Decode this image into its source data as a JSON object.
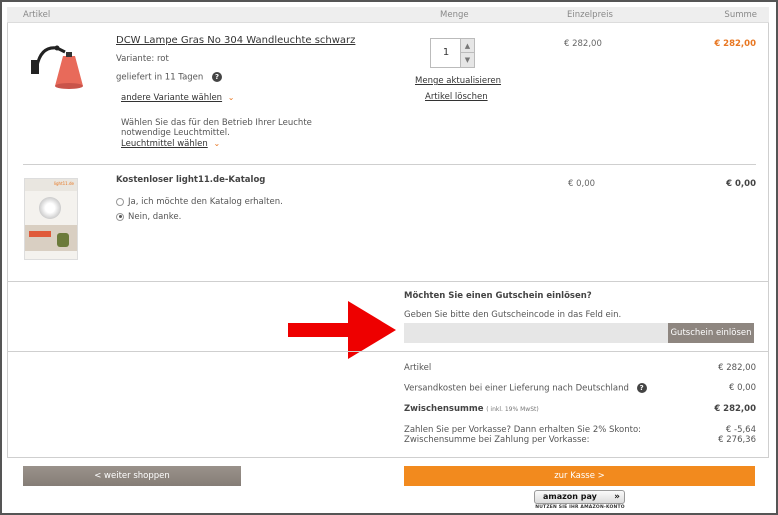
{
  "header": {
    "col_article": "Artikel",
    "col_qty": "Menge",
    "col_unit": "Einzelpreis",
    "col_sum": "Summe"
  },
  "item1": {
    "name": "DCW Lampe Gras No 304 Wandleuchte schwarz",
    "variant": "Variante: rot",
    "delivery": "geliefert in 11 Tagen",
    "other_variant": "andere Variante wählen",
    "bulb_note": "Wählen Sie das für den Betrieb Ihrer Leuchte notwendige Leuchtmittel.",
    "bulb_link": "Leuchtmittel wählen",
    "qty": "1",
    "update_link": "Menge aktualisieren",
    "delete_link": "Artikel löschen",
    "unit_price": "€ 282,00",
    "sum": "€ 282,00"
  },
  "item2": {
    "name": "Kostenloser light11.de-Katalog",
    "option_yes": "Ja, ich möchte den Katalog erhalten.",
    "option_no": "Nein, danke.",
    "unit_price": "€ 0,00",
    "sum": "€ 0,00",
    "catalog_brand": "light11.de"
  },
  "coupon": {
    "title": "Möchten Sie einen Gutschein einlösen?",
    "hint": "Geben Sie bitte den Gutscheincode in das Feld ein.",
    "input_value": "",
    "button": "Gutschein einlösen"
  },
  "totals": {
    "article_label": "Artikel",
    "article_value": "€ 282,00",
    "shipping_label": "Versandkosten bei einer Lieferung nach Deutschland",
    "shipping_value": "€ 0,00",
    "subtotal_label": "Zwischensumme",
    "subtotal_note": "( inkl. 19% MwSt)",
    "subtotal_value": "€ 282,00",
    "prepay_line1": "Zahlen Sie per Vorkasse? Dann erhalten Sie 2% Skonto:",
    "prepay_line2": "Zwischensumme bei Zahlung per Vorkasse:",
    "prepay_value1": "€ -5,64",
    "prepay_value2": "€ 276,36"
  },
  "actions": {
    "continue_shopping": "< weiter shoppen",
    "checkout": "zur Kasse >",
    "amazon_pay": "amazon pay",
    "amazon_sub": "NUTZEN SIE IHR AMAZON-KONTO"
  },
  "colors": {
    "accent_orange": "#e87722",
    "arrow_red": "#ee0000",
    "checkout_bg": "#f28a1e"
  }
}
